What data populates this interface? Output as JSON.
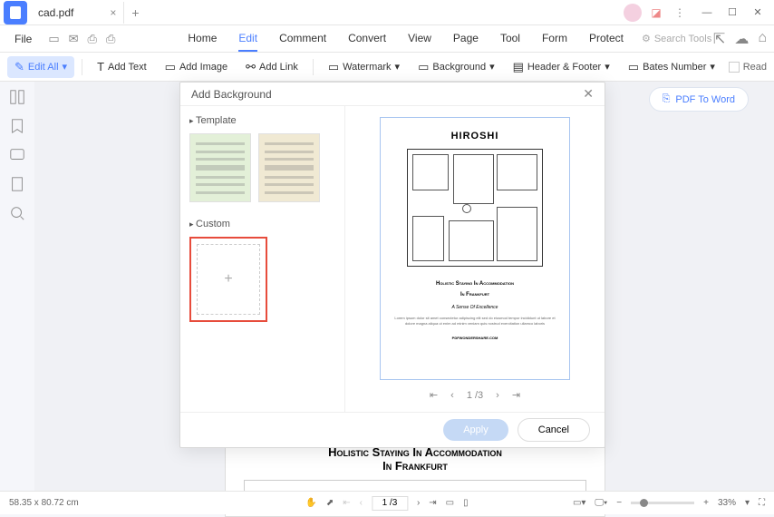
{
  "titlebar": {
    "tab_name": "cad.pdf"
  },
  "menubar": {
    "file": "File",
    "items": [
      "Home",
      "Edit",
      "Comment",
      "Convert",
      "View",
      "Page",
      "Tool",
      "Form",
      "Protect"
    ],
    "active_index": 1,
    "search_placeholder": "Search Tools"
  },
  "toolbar": {
    "edit_all": "Edit All",
    "add_text": "Add Text",
    "add_image": "Add Image",
    "add_link": "Add Link",
    "watermark": "Watermark",
    "background": "Background",
    "header_footer": "Header & Footer",
    "bates_number": "Bates Number",
    "read": "Read"
  },
  "pdf_to_word": "PDF To Word",
  "dialog": {
    "title": "Add Background",
    "template_label": "Template",
    "custom_label": "Custom",
    "page_indicator": "1 /3",
    "apply": "Apply",
    "cancel": "Cancel"
  },
  "preview": {
    "title": "HIROSHI",
    "subtitle": "Holistic Staying In Accommodation",
    "subtitle2": "In Frankfurt",
    "tagline": "A Sense Of Excellence",
    "url": "PDFWONDERSHARE.COM"
  },
  "doc_behind": {
    "title": "Holistic Staying In Accommodation",
    "title2": "In Frankfurt"
  },
  "statusbar": {
    "dimensions": "58.35 x 80.72 cm",
    "page": "1 /3",
    "zoom": "33%"
  }
}
